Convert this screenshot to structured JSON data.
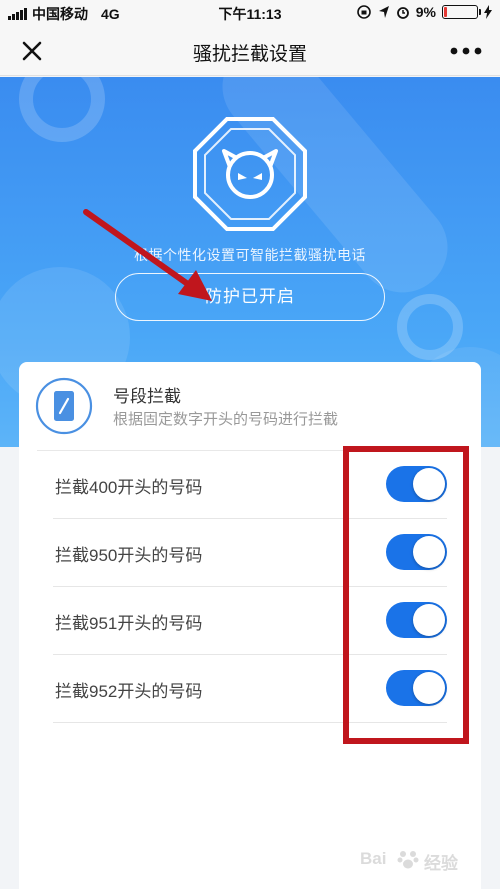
{
  "status_bar": {
    "carrier": "中国移动",
    "network": "4G",
    "time": "下午11:13",
    "battery": "9%",
    "battery_level": 0.09
  },
  "nav": {
    "title": "骚扰拦截设置"
  },
  "hero": {
    "description": "根据个性化设置可智能拦截骚扰电话",
    "protect_button": "防护已开启"
  },
  "card": {
    "title": "号段拦截",
    "description": "根据固定数字开头的号码进行拦截",
    "rows": [
      {
        "label": "拦截400开头的号码",
        "enabled": true
      },
      {
        "label": "拦截950开头的号码",
        "enabled": true
      },
      {
        "label": "拦截951开头的号码",
        "enabled": true
      },
      {
        "label": "拦截952开头的号码",
        "enabled": true
      }
    ]
  },
  "watermark": {
    "brand_left": "Bai",
    "brand_right": "经验"
  },
  "colors": {
    "accent": "#1a73e8",
    "hero_top": "#3a8cf0",
    "annotation_red": "#c0161d"
  },
  "icons": [
    "close-icon",
    "more-icon",
    "shield-devil-icon",
    "phone-icon"
  ]
}
